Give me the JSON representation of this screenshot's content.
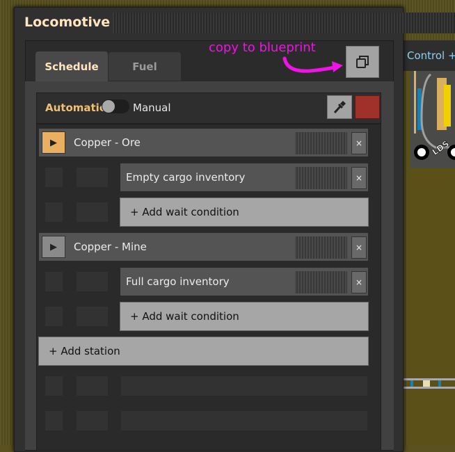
{
  "window": {
    "title": "Locomotive"
  },
  "tabs": [
    {
      "label": "Schedule",
      "active": true
    },
    {
      "label": "Fuel",
      "active": false
    }
  ],
  "annotation": {
    "text": "copy to blueprint",
    "color": "#f012e6"
  },
  "copy_button": {
    "icon": "copy-icon"
  },
  "mode": {
    "automatic_label": "Automatic",
    "manual_label": "Manual",
    "is_automatic": false
  },
  "color_swatch": "#a0302a",
  "schedule": {
    "stations": [
      {
        "name": "Copper - Ore",
        "active": true,
        "conditions": [
          "Empty cargo inventory"
        ],
        "add_condition_label": "+ Add wait condition"
      },
      {
        "name": "Copper - Mine",
        "active": false,
        "conditions": [
          "Full cargo inventory"
        ],
        "add_condition_label": "+ Add wait condition"
      }
    ],
    "add_station_label": "+ Add station",
    "close_glyph": "×",
    "play_glyph": "▶"
  },
  "minimap": {
    "header": "Control +",
    "station_label": "LDS"
  }
}
